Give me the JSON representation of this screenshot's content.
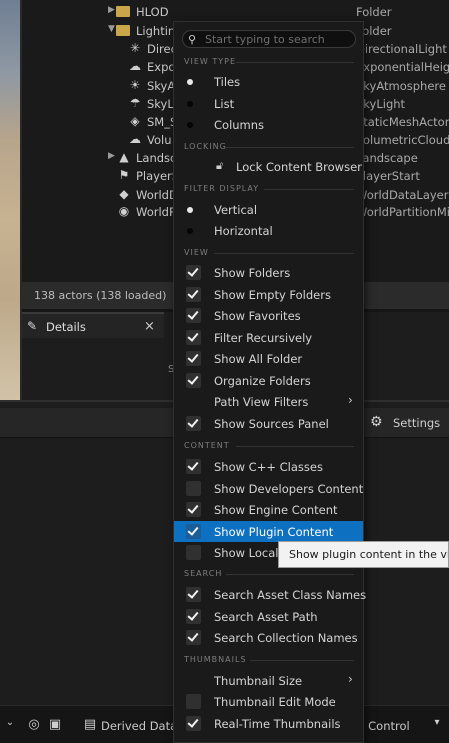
{
  "outliner": {
    "rows": [
      {
        "name": "HLOD",
        "type": "Folder",
        "icon": "folder-icon"
      },
      {
        "name": "Lighting",
        "type": "Folder",
        "icon": "folder-icon"
      },
      {
        "name": "Direc",
        "type": "DirectionalLight",
        "icon": "sun-icon"
      },
      {
        "name": "Expo",
        "type": "ExponentialHeight",
        "icon": "fog-icon"
      },
      {
        "name": "SkyA",
        "type": "SkyAtmosphere",
        "icon": "sky-atmosphere-icon"
      },
      {
        "name": "SkyL",
        "type": "SkyLight",
        "icon": "skylight-icon"
      },
      {
        "name": "SM_S",
        "type": "StaticMeshActor",
        "icon": "static-mesh-icon"
      },
      {
        "name": "Volu",
        "type": "VolumetricCloud",
        "icon": "cloud-icon"
      },
      {
        "name": "Landsc",
        "type": "Landscape",
        "icon": "landscape-icon"
      },
      {
        "name": "PlayerS",
        "type": "PlayerStart",
        "icon": "player-start-icon"
      },
      {
        "name": "WorldD",
        "type": "WorldDataLayers",
        "icon": "data-layers-icon"
      },
      {
        "name": "WorldP",
        "type": "WorldPartitionMini",
        "icon": "world-partition-icon"
      }
    ],
    "actor_count": "138 actors (138 loaded)"
  },
  "details": {
    "tab_label": "Details",
    "close_glyph": "×",
    "partial_text": "S"
  },
  "settings_label": "Settings",
  "bottom_toolbar": {
    "derived_data": "Derived Data",
    "source_control": "Source Control"
  },
  "menu": {
    "search_placeholder": "Start typing to search",
    "sections": {
      "view_type": "VIEW TYPE",
      "locking": "LOCKING",
      "filter_display": "FILTER DISPLAY",
      "view": "VIEW",
      "content": "CONTENT",
      "search": "SEARCH",
      "thumbnails": "THUMBNAILS"
    },
    "view_type": [
      {
        "label": "Tiles",
        "selected": true
      },
      {
        "label": "List",
        "selected": false
      },
      {
        "label": "Columns",
        "selected": false
      }
    ],
    "locking": {
      "label": "Lock Content Browser"
    },
    "filter_display": [
      {
        "label": "Vertical",
        "selected": true
      },
      {
        "label": "Horizontal",
        "selected": false
      }
    ],
    "view": [
      {
        "label": "Show Folders",
        "checked": true
      },
      {
        "label": "Show Empty Folders",
        "checked": true
      },
      {
        "label": "Show Favorites",
        "checked": true
      },
      {
        "label": "Filter Recursively",
        "checked": true
      },
      {
        "label": "Show All Folder",
        "checked": true
      },
      {
        "label": "Organize Folders",
        "checked": true
      },
      {
        "label": "Path View Filters",
        "submenu": true
      },
      {
        "label": "Show Sources Panel",
        "checked": true
      }
    ],
    "content": [
      {
        "label": "Show C++ Classes",
        "checked": true
      },
      {
        "label": "Show Developers Content",
        "checked": false
      },
      {
        "label": "Show Engine Content",
        "checked": true
      },
      {
        "label": "Show Plugin Content",
        "checked": true,
        "highlighted": true
      },
      {
        "label": "Show Locali",
        "checked": false
      }
    ],
    "search": [
      {
        "label": "Search Asset Class Names",
        "checked": true
      },
      {
        "label": "Search Asset Path",
        "checked": true
      },
      {
        "label": "Search Collection Names",
        "checked": true
      }
    ],
    "thumbnails": [
      {
        "label": "Thumbnail Size",
        "submenu": true
      },
      {
        "label": "Thumbnail Edit Mode",
        "checked": false
      },
      {
        "label": "Real-Time Thumbnails",
        "checked": true
      }
    ]
  },
  "tooltip": "Show plugin content in the view?",
  "colors": {
    "highlight": "#0e70c0",
    "folder": "#c9a64a",
    "menu_bg": "#1a1a1a"
  }
}
